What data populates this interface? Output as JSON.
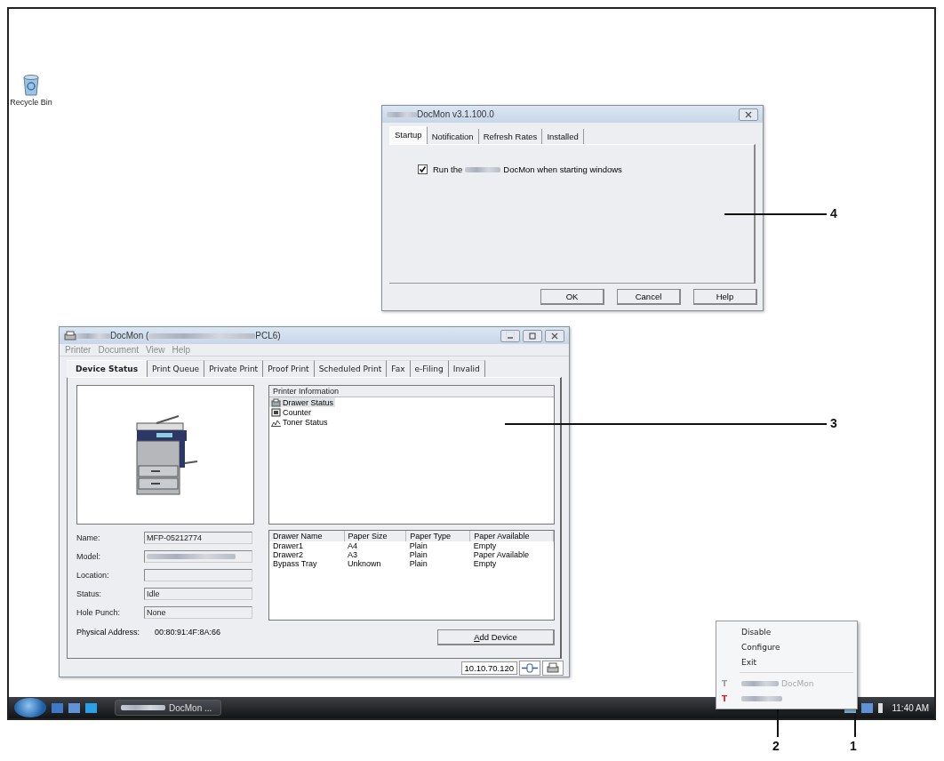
{
  "desktop_icons": [
    {
      "label": "Recycle Bin"
    }
  ],
  "settings_dialog": {
    "title": "DocMon  v3.1.100.0",
    "tabs": [
      {
        "label": "Startup",
        "selected": true
      },
      {
        "label": "Notification",
        "selected": false
      },
      {
        "label": "Refresh Rates",
        "selected": false
      },
      {
        "label": "Installed",
        "selected": false
      }
    ],
    "startup_option": {
      "label_start": "Run the",
      "label_end": "DocMon when starting windows",
      "checked": true
    },
    "buttons": [
      "OK",
      "Cancel",
      "Help"
    ]
  },
  "main_window": {
    "title_start": "DocMon (",
    "title_end": "PCL6)",
    "menu": [
      "Printer",
      "Document",
      "View",
      "Help"
    ],
    "tabs": [
      {
        "label": "Device Status",
        "selected": true
      },
      {
        "label": "Print Queue",
        "selected": false
      },
      {
        "label": "Private Print",
        "selected": false
      },
      {
        "label": "Proof Print",
        "selected": false
      },
      {
        "label": "Scheduled Print",
        "selected": false
      },
      {
        "label": "Fax",
        "selected": false
      },
      {
        "label": "e-Filing",
        "selected": false
      },
      {
        "label": "Invalid",
        "selected": false
      }
    ],
    "fields": [
      {
        "label": "Name:",
        "value": "MFP-05212774"
      },
      {
        "label": "Model:",
        "value_blurred": true
      },
      {
        "label": "Location:"
      },
      {
        "label": "Status:",
        "value": "Idle"
      },
      {
        "label": "Hole Punch:",
        "value": "None"
      }
    ],
    "physical_address": {
      "label": "Physical Address:",
      "value": "00:80:91:4F:8A:66"
    },
    "printer_information": {
      "header": "Printer Information",
      "items": [
        {
          "label": "Drawer Status",
          "kind": "drawer",
          "selected": true
        },
        {
          "label": "Counter",
          "kind": "counter",
          "selected": false
        },
        {
          "label": "Toner Status",
          "kind": "toner",
          "selected": false
        }
      ]
    },
    "drawer_table": {
      "columns": [
        "Drawer Name",
        "Paper Size",
        "Paper Type",
        "Paper Available"
      ],
      "rows": [
        [
          "Drawer1",
          "A4",
          "Plain",
          "Empty"
        ],
        [
          "Drawer2",
          "A3",
          "Plain",
          "Paper Available"
        ],
        [
          "Bypass Tray",
          "Unknown",
          "Plain",
          "Empty"
        ]
      ]
    },
    "add_button": "Add Device",
    "status_bar": {
      "address": "10.10.70.120"
    }
  },
  "tray_menu": {
    "items": [
      {
        "label": "Disable",
        "disabled": false
      },
      {
        "label": "Configure",
        "disabled": false
      },
      {
        "label": "Exit",
        "disabled": false
      },
      {
        "label": "DocMon",
        "disabled": true,
        "icon": "T",
        "color": "#9a9a9a"
      },
      {
        "disabled": true,
        "icon": "T",
        "color": "#d21f1f"
      }
    ]
  },
  "taskbar": {
    "task_button": "DocMon ...",
    "clock": "11:40 AM"
  },
  "callouts": [
    {
      "number": "4",
      "kind": "right"
    },
    {
      "number": "3",
      "kind": "right"
    },
    {
      "number": "2",
      "kind": "below"
    },
    {
      "number": "1",
      "kind": "below"
    }
  ]
}
